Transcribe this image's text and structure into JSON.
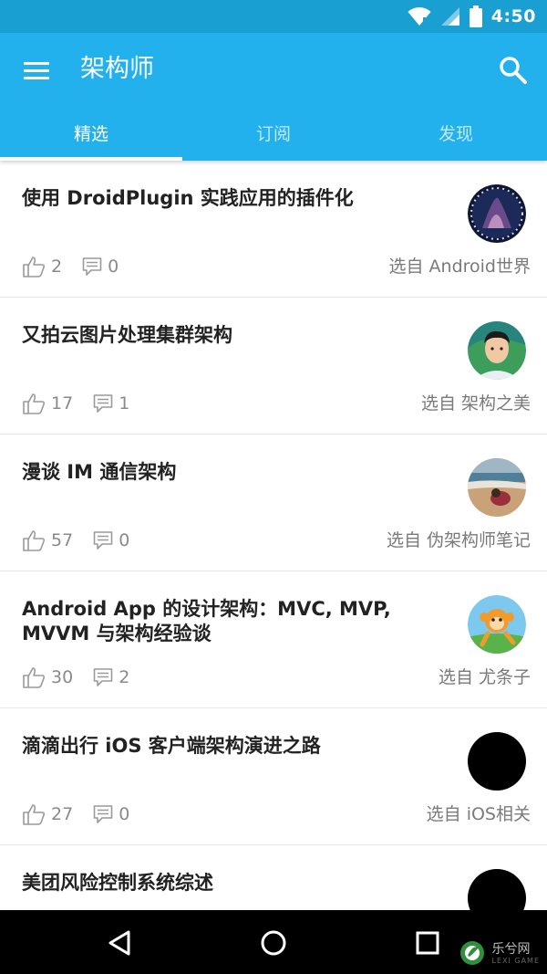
{
  "status_bar": {
    "time": "4:50"
  },
  "app_bar": {
    "title": "架构师"
  },
  "tabs": [
    {
      "label": "精选",
      "active": true
    },
    {
      "label": "订阅",
      "active": false
    },
    {
      "label": "发现",
      "active": false
    }
  ],
  "articles": [
    {
      "title": "使用 DroidPlugin 实践应用的插件化",
      "likes": "2",
      "comments": "0",
      "source": "选自 Android世界",
      "avatar": "galaxy-avatar"
    },
    {
      "title": "又拍云图片处理集群架构",
      "likes": "17",
      "comments": "1",
      "source": "选自 架构之美",
      "avatar": "cartoon-man-avatar"
    },
    {
      "title": "漫谈 IM 通信架构",
      "likes": "57",
      "comments": "0",
      "source": "选自 伪架构师笔记",
      "avatar": "beach-photo-avatar"
    },
    {
      "title": "Android App 的设计架构：MVC, MVP, MVVM 与架构经验谈",
      "likes": "30",
      "comments": "2",
      "source": "选自 尤条子",
      "avatar": "monkey-avatar"
    },
    {
      "title": "滴滴出行 iOS 客户端架构演进之路",
      "likes": "27",
      "comments": "0",
      "source": "选自  iOS相关",
      "avatar": "black-avatar"
    },
    {
      "title": "美团风险控制系统综述",
      "avatar": "black-avatar"
    }
  ],
  "watermark": {
    "text": "乐兮网",
    "sub": "LEXI GAME"
  },
  "colors": {
    "primary": "#22b1ec",
    "status_bar": "#1a9fd3",
    "nav_bar": "#000000"
  }
}
